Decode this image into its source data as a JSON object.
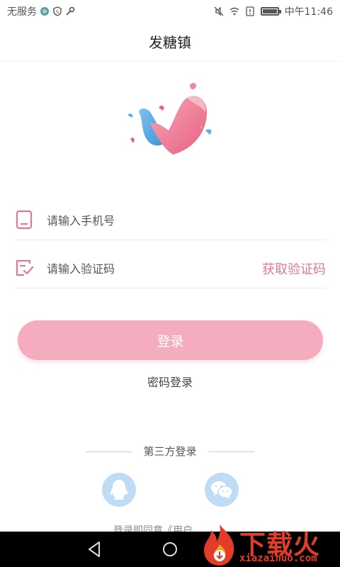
{
  "status_bar": {
    "carrier": "无服务",
    "time": "中午11:46"
  },
  "header": {
    "title": "发糖镇"
  },
  "form": {
    "phone_placeholder": "请输入手机号",
    "code_placeholder": "请输入验证码",
    "get_code_label": "获取验证码",
    "login_label": "登录",
    "password_login_label": "密码登录"
  },
  "third_party": {
    "label": "第三方登录",
    "icons": [
      "qq-icon",
      "wechat-icon"
    ]
  },
  "agreement": {
    "text": "登录即同意《用户"
  },
  "watermark": {
    "brand": "下载火",
    "url": "xiazaihuo.com"
  },
  "colors": {
    "accent": "#e07a94",
    "button": "#f4acbe",
    "social": "#bfdcf6"
  }
}
